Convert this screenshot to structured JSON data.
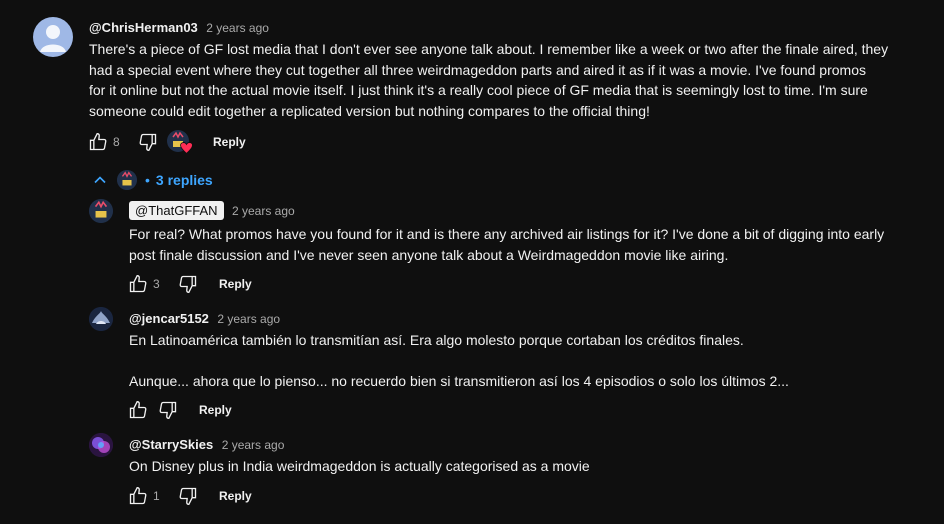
{
  "comments": [
    {
      "handle": "@ChrisHerman03",
      "time": "2 years ago",
      "lines": [
        "There's a piece of GF lost media that I don't ever see anyone talk about. I remember like a week or two after the finale aired, they",
        "had a special event where they cut together all three weirdmageddon parts and aired it as if it was a movie. I've found promos",
        "for it online but not the actual movie itself. I just think it's a really cool piece of GF media that is seemingly lost to time. I'm sure",
        "someone could edit together a replicated version but nothing compares to the official thing!"
      ],
      "likes": "8",
      "reply_label": "Reply"
    }
  ],
  "replies_toggle": {
    "label": "3 replies",
    "bullet": "•"
  },
  "replies": [
    {
      "handle": "@ThatGFFAN",
      "time": "2 years ago",
      "lines": [
        "For real? What promos have you found for it and is there any archived air listings for it? I've done a bit of digging into early",
        "post finale discussion and I've never seen anyone talk about a Weirdmageddon movie like airing."
      ],
      "likes": "3",
      "reply_label": "Reply"
    },
    {
      "handle": "@jencar5152",
      "time": "2 years ago",
      "lines": [
        "En Latinoamérica también lo transmitían así. Era algo molesto porque cortaban los créditos finales.",
        "",
        "Aunque... ahora que lo pienso... no recuerdo bien si transmitieron así los 4 episodios o solo los últimos 2..."
      ],
      "likes": "",
      "reply_label": "Reply"
    },
    {
      "handle": "@StarrySkies",
      "time": "2 years ago",
      "lines": [
        "On Disney plus in India weirdmageddon is actually categorised as a movie"
      ],
      "likes": "1",
      "reply_label": "Reply"
    }
  ],
  "icons": {
    "like": "thumbs-up-icon",
    "dislike": "thumbs-down-icon",
    "collapse": "chevron-up-icon"
  },
  "colors": {
    "background": "#0f0f0f",
    "link": "#3ea6ff",
    "secondary_text": "#aaaaaa"
  }
}
